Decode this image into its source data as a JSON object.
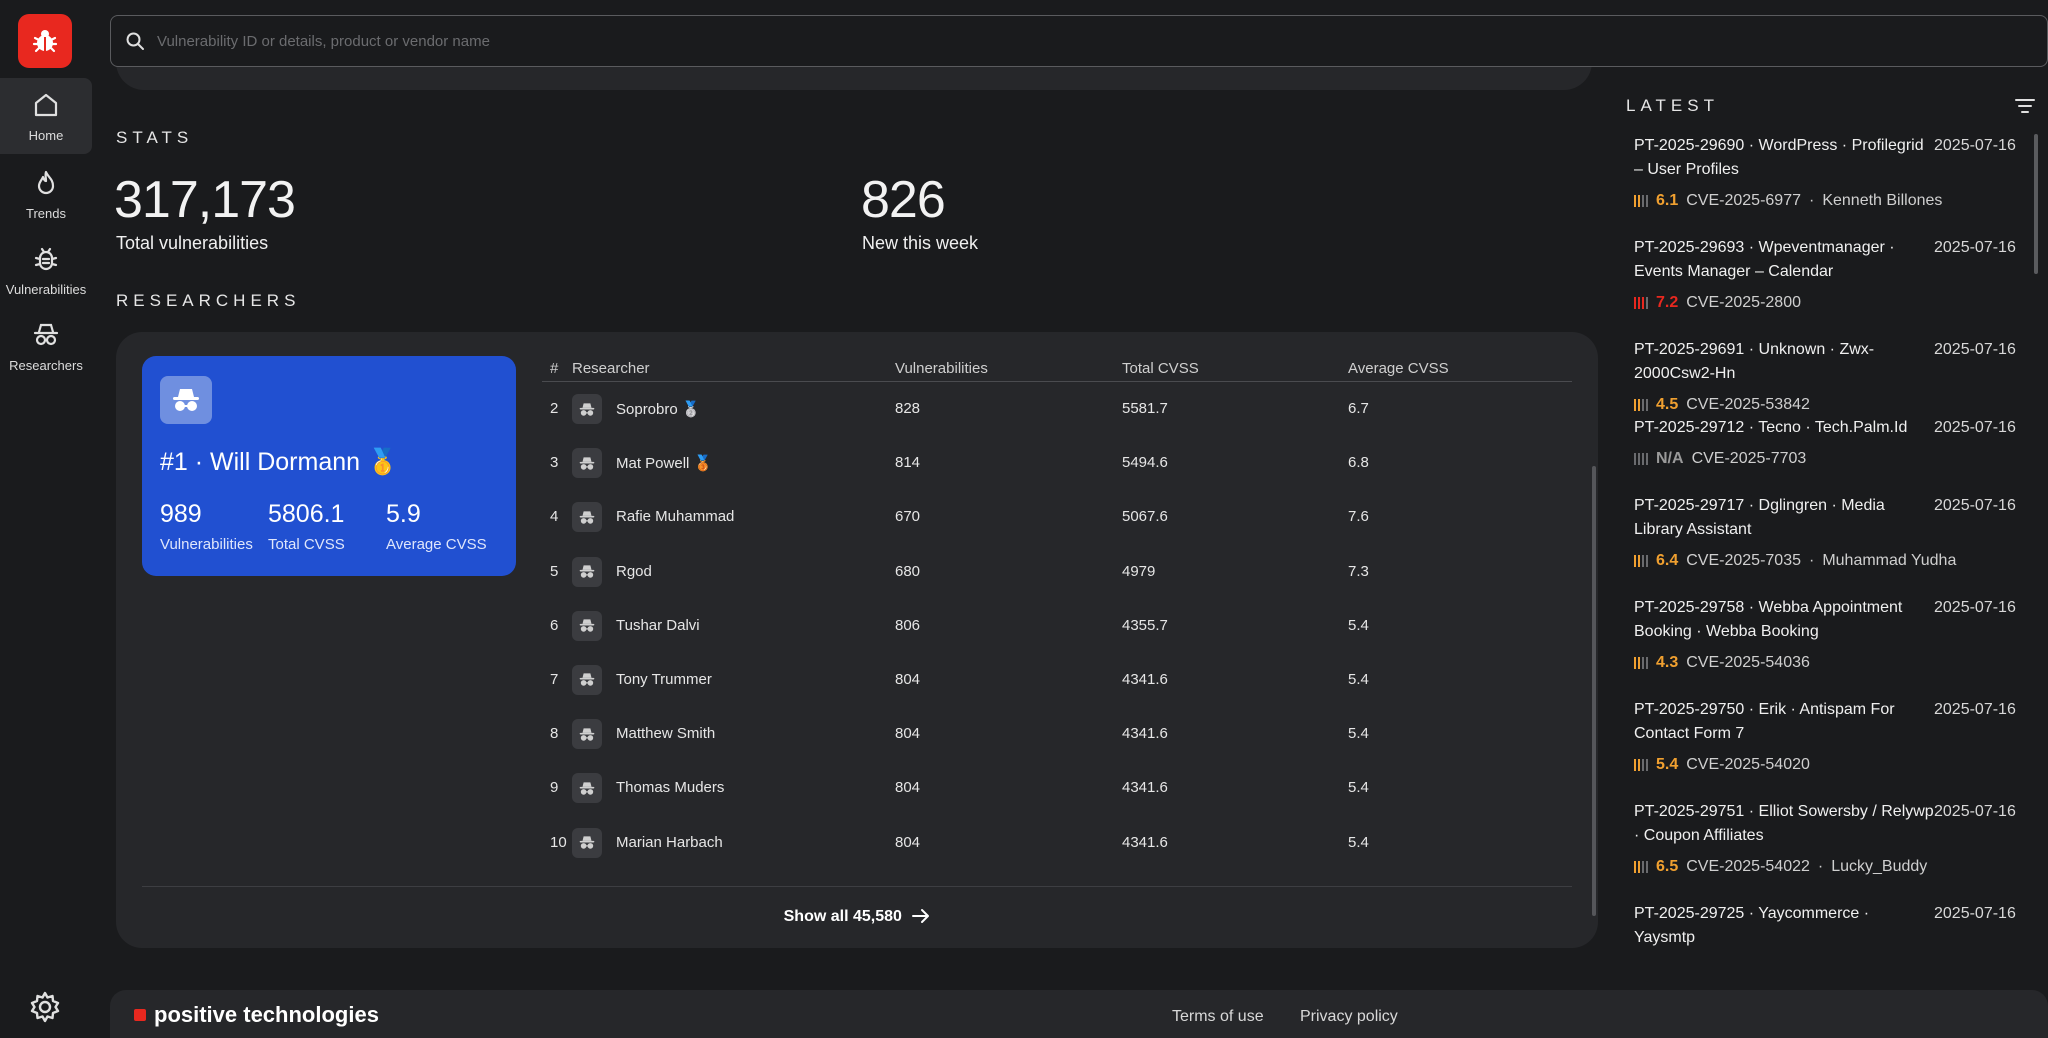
{
  "search": {
    "placeholder": "Vulnerability ID or details, product or vendor name"
  },
  "nav": [
    {
      "label": "Home",
      "icon": "home-icon",
      "active": true
    },
    {
      "label": "Trends",
      "icon": "flame-icon"
    },
    {
      "label": "Vulnerabilities",
      "icon": "bug-icon"
    },
    {
      "label": "Researchers",
      "icon": "spy-icon"
    }
  ],
  "stats": {
    "label": "STATS",
    "total_value": "317,173",
    "total_label": "Total vulnerabilities",
    "week_value": "826",
    "week_label": "New this week"
  },
  "researchers": {
    "label": "RESEARCHERS",
    "top": {
      "title": "#1 · Will Dormann 🥇",
      "vulns": "989",
      "vulns_label": "Vulnerabilities",
      "total": "5806.1",
      "total_label": "Total CVSS",
      "avg": "5.9",
      "avg_label": "Average CVSS"
    },
    "headers": {
      "rank": "#",
      "name": "Researcher",
      "vulns": "Vulnerabilities",
      "total": "Total CVSS",
      "avg": "Average CVSS"
    },
    "rows": [
      {
        "rank": "2",
        "name": "Soprobro 🥈",
        "vulns": "828",
        "total": "5581.7",
        "avg": "6.7"
      },
      {
        "rank": "3",
        "name": "Mat Powell 🥉",
        "vulns": "814",
        "total": "5494.6",
        "avg": "6.8"
      },
      {
        "rank": "4",
        "name": "Rafie Muhammad",
        "vulns": "670",
        "total": "5067.6",
        "avg": "7.6"
      },
      {
        "rank": "5",
        "name": "Rgod",
        "vulns": "680",
        "total": "4979",
        "avg": "7.3"
      },
      {
        "rank": "6",
        "name": "Tushar Dalvi",
        "vulns": "806",
        "total": "4355.7",
        "avg": "5.4"
      },
      {
        "rank": "7",
        "name": "Tony Trummer",
        "vulns": "804",
        "total": "4341.6",
        "avg": "5.4"
      },
      {
        "rank": "8",
        "name": "Matthew Smith",
        "vulns": "804",
        "total": "4341.6",
        "avg": "5.4"
      },
      {
        "rank": "9",
        "name": "Thomas Muders",
        "vulns": "804",
        "total": "4341.6",
        "avg": "5.4"
      },
      {
        "rank": "10",
        "name": "Marian Harbach",
        "vulns": "804",
        "total": "4341.6",
        "avg": "5.4"
      }
    ],
    "show_all": "Show all 45,580"
  },
  "latest": {
    "title": "LATEST",
    "items": [
      {
        "title": "PT-2025-29690 · WordPress · Profilegrid – User Profiles",
        "date": "2025-07-16",
        "score": "6.1",
        "level": 2,
        "color": "#f0a030",
        "cve": "CVE-2025-6977",
        "author": "Kenneth Billones"
      },
      {
        "title": "PT-2025-29693 · Wpeventmanager · Events Manager – Calendar",
        "date": "2025-07-16",
        "score": "7.2",
        "level": 3,
        "color": "#e8281f",
        "cve": "CVE-2025-2800",
        "author": ""
      },
      {
        "title": "PT-2025-29691 · Unknown · Zwx-2000Csw2-Hn",
        "date": "2025-07-16",
        "score": "4.5",
        "level": 2,
        "color": "#f0a030",
        "cve": "CVE-2025-53842",
        "author": ""
      },
      {
        "title": "PT-2025-29712 · Tecno · Tech.Palm.Id",
        "date": "2025-07-16",
        "score": "N/A",
        "level": 0,
        "color": "#9a9a9a",
        "cve": "CVE-2025-7703",
        "author": ""
      },
      {
        "title": "PT-2025-29717 · Dglingren · Media Library Assistant",
        "date": "2025-07-16",
        "score": "6.4",
        "level": 2,
        "color": "#f0a030",
        "cve": "CVE-2025-7035",
        "author": "Muhammad Yudha"
      },
      {
        "title": "PT-2025-29758 · Webba Appointment Booking · Webba Booking",
        "date": "2025-07-16",
        "score": "4.3",
        "level": 2,
        "color": "#f0a030",
        "cve": "CVE-2025-54036",
        "author": ""
      },
      {
        "title": "PT-2025-29750 · Erik · Antispam For Contact Form 7",
        "date": "2025-07-16",
        "score": "5.4",
        "level": 2,
        "color": "#f0a030",
        "cve": "CVE-2025-54020",
        "author": ""
      },
      {
        "title": "PT-2025-29751 · Elliot Sowersby / Relywp · Coupon Affiliates",
        "date": "2025-07-16",
        "score": "6.5",
        "level": 2,
        "color": "#f0a030",
        "cve": "CVE-2025-54022",
        "author": "Lucky_Buddy"
      },
      {
        "title": "PT-2025-29725 · Yaycommerce · Yaysmtp",
        "date": "2025-07-16",
        "score": "",
        "level": 0,
        "color": "#9a9a9a",
        "cve": "",
        "author": ""
      }
    ]
  },
  "footer": {
    "brand": "positive technologies",
    "terms": "Terms of use",
    "privacy": "Privacy policy"
  }
}
